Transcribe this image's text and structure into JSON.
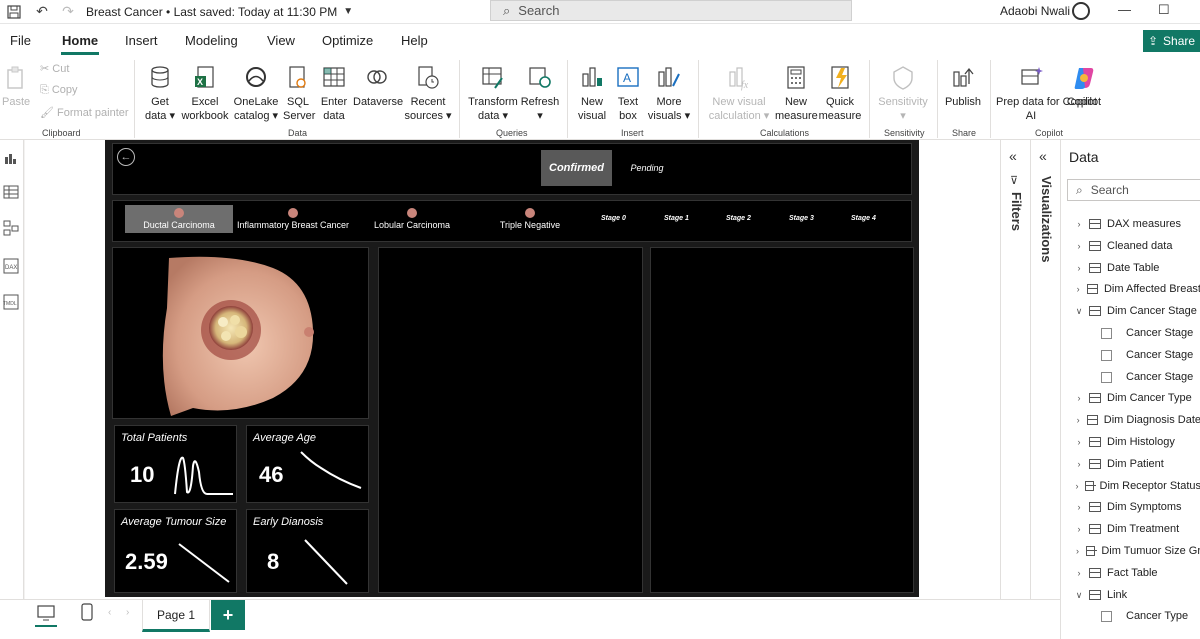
{
  "titlebar": {
    "title": "Breast Cancer • Last saved: Today at 11:30 PM",
    "search_placeholder": "Search",
    "user": "Adaobi Nwali"
  },
  "menu": {
    "items": [
      "File",
      "Home",
      "Insert",
      "Modeling",
      "View",
      "Optimize",
      "Help"
    ],
    "active": "Home",
    "share": "Share"
  },
  "ribbon": {
    "clipboard": {
      "paste": "Paste",
      "cut": "Cut",
      "copy": "Copy",
      "format_painter": "Format painter",
      "group": "Clipboard"
    },
    "data": {
      "get_data": [
        "Get",
        "data ▾"
      ],
      "excel": [
        "Excel",
        "workbook"
      ],
      "onelake": [
        "OneLake",
        "catalog ▾"
      ],
      "sql": [
        "SQL",
        "Server"
      ],
      "enter": [
        "Enter",
        "data"
      ],
      "dataverse": [
        "Dataverse",
        ""
      ],
      "recent": [
        "Recent",
        "sources ▾"
      ],
      "group": "Data"
    },
    "queries": {
      "transform": [
        "Transform",
        "data ▾"
      ],
      "refresh": [
        "Refresh",
        "▾"
      ],
      "group": "Queries"
    },
    "insert": {
      "new_visual": [
        "New",
        "visual"
      ],
      "text_box": [
        "Text",
        "box"
      ],
      "more_visuals": [
        "More",
        "visuals ▾"
      ],
      "group": "Insert"
    },
    "calculations": {
      "new_visual_calc": [
        "New visual",
        "calculation ▾"
      ],
      "new_measure": [
        "New",
        "measure"
      ],
      "quick_measure": [
        "Quick",
        "measure"
      ],
      "group": "Calculations"
    },
    "sensitivity": {
      "label": [
        "Sensitivity",
        "▾"
      ],
      "group": "Sensitivity"
    },
    "share": {
      "publish": [
        "Publish",
        ""
      ],
      "group": "Share"
    },
    "copilot": {
      "prep": [
        "Prep data for Copilot",
        "AI"
      ],
      "copilot": [
        "Copilot",
        ""
      ],
      "group": "Copilot"
    }
  },
  "report": {
    "status_buttons": [
      "Confirmed",
      "Pending"
    ],
    "active_status": "Confirmed",
    "cancer_types": [
      "Ductal Carcinoma",
      "Inflammatory Breast Cancer",
      "Lobular Carcinoma",
      "Triple Negative"
    ],
    "active_cancer_type": "Ductal Carcinoma",
    "stages": [
      "Stage 0",
      "Stage 1",
      "Stage 2",
      "Stage 3",
      "Stage 4"
    ],
    "kpis": [
      {
        "title": "Total Patients",
        "value": "10"
      },
      {
        "title": "Average Age",
        "value": "46"
      },
      {
        "title": "Average Tumour Size",
        "value": "2.59"
      },
      {
        "title": "Early Dianosis",
        "value": "8"
      }
    ]
  },
  "panes": {
    "filters": "Filters",
    "visualizations": "Visualizations",
    "data_title": "Data",
    "data_search": "Search",
    "tree": [
      {
        "label": "DAX measures",
        "type": "table",
        "expanded": false
      },
      {
        "label": "Cleaned data",
        "type": "table",
        "expanded": false
      },
      {
        "label": "Date Table",
        "type": "table",
        "expanded": false
      },
      {
        "label": "Dim Affected Breast",
        "type": "table",
        "expanded": false
      },
      {
        "label": "Dim Cancer Stage",
        "type": "table",
        "expanded": true
      },
      {
        "label": "Cancer Stage",
        "type": "field"
      },
      {
        "label": "Cancer Stage",
        "type": "field"
      },
      {
        "label": "Cancer Stage",
        "type": "field"
      },
      {
        "label": "Dim Cancer Type",
        "type": "table",
        "expanded": false
      },
      {
        "label": "Dim Diagnosis Date",
        "type": "table",
        "expanded": false
      },
      {
        "label": "Dim Histology",
        "type": "table",
        "expanded": false
      },
      {
        "label": "Dim Patient",
        "type": "table",
        "expanded": false
      },
      {
        "label": "Dim Receptor Status",
        "type": "table",
        "expanded": false
      },
      {
        "label": "Dim Symptoms",
        "type": "table",
        "expanded": false
      },
      {
        "label": "Dim Treatment",
        "type": "table",
        "expanded": false
      },
      {
        "label": "Dim Tumuor Size Gr",
        "type": "table",
        "expanded": false
      },
      {
        "label": "Fact Table",
        "type": "table",
        "expanded": false
      },
      {
        "label": "Link",
        "type": "table",
        "expanded": true
      },
      {
        "label": "Cancer Type",
        "type": "field"
      }
    ]
  },
  "bottom": {
    "page_tab": "Page 1",
    "add_page": "+"
  },
  "colors": {
    "accent": "#117865",
    "report_bg": "#000000",
    "active_seg": "#595959"
  }
}
